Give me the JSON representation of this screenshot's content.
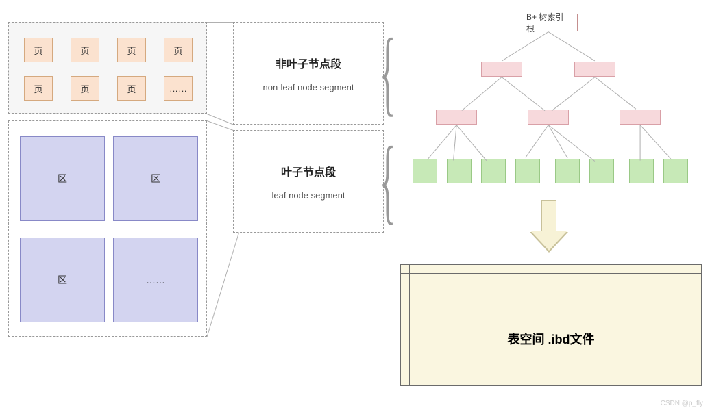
{
  "pages": {
    "row1": [
      "页",
      "页",
      "页",
      "页"
    ],
    "row2": [
      "页",
      "页",
      "页",
      "……"
    ]
  },
  "extents": {
    "row1": [
      "区",
      "区"
    ],
    "row2": [
      "区",
      "……"
    ]
  },
  "segments": {
    "nonleaf": {
      "title": "非叶子节点段",
      "subtitle": "non-leaf node segment"
    },
    "leaf": {
      "title": "叶子节点段",
      "subtitle": "leaf node segment"
    }
  },
  "tree": {
    "root_label": "B+ 树索引根",
    "internal_levels": 2,
    "level1_count": 2,
    "level2_count": 3,
    "leaf_count": 8
  },
  "tablespace": {
    "label": "表空间 .ibd文件"
  },
  "watermark": "CSDN @p_fly",
  "colors": {
    "page_fill": "#fbe2cf",
    "extent_fill": "#d3d4f0",
    "internal_node_fill": "#f7d9dc",
    "leaf_node_fill": "#c7e9b7",
    "tablespace_fill": "#faf6e0"
  },
  "chart_data": {
    "type": "diagram",
    "description": "InnoDB storage hierarchy: pages group into extents; B+ tree has non-leaf segment (root + 2 internal levels) and leaf segment (8 leaf nodes); both segments stored in tablespace .ibd file",
    "entities": [
      "页 (page)",
      "区 (extent)",
      "非叶子节点段 (non-leaf segment)",
      "叶子节点段 (leaf segment)",
      "表空间 .ibd (tablespace)"
    ],
    "btree": {
      "levels": 4,
      "root": 1,
      "level1": 2,
      "level2": 3,
      "leaves": 8
    }
  }
}
